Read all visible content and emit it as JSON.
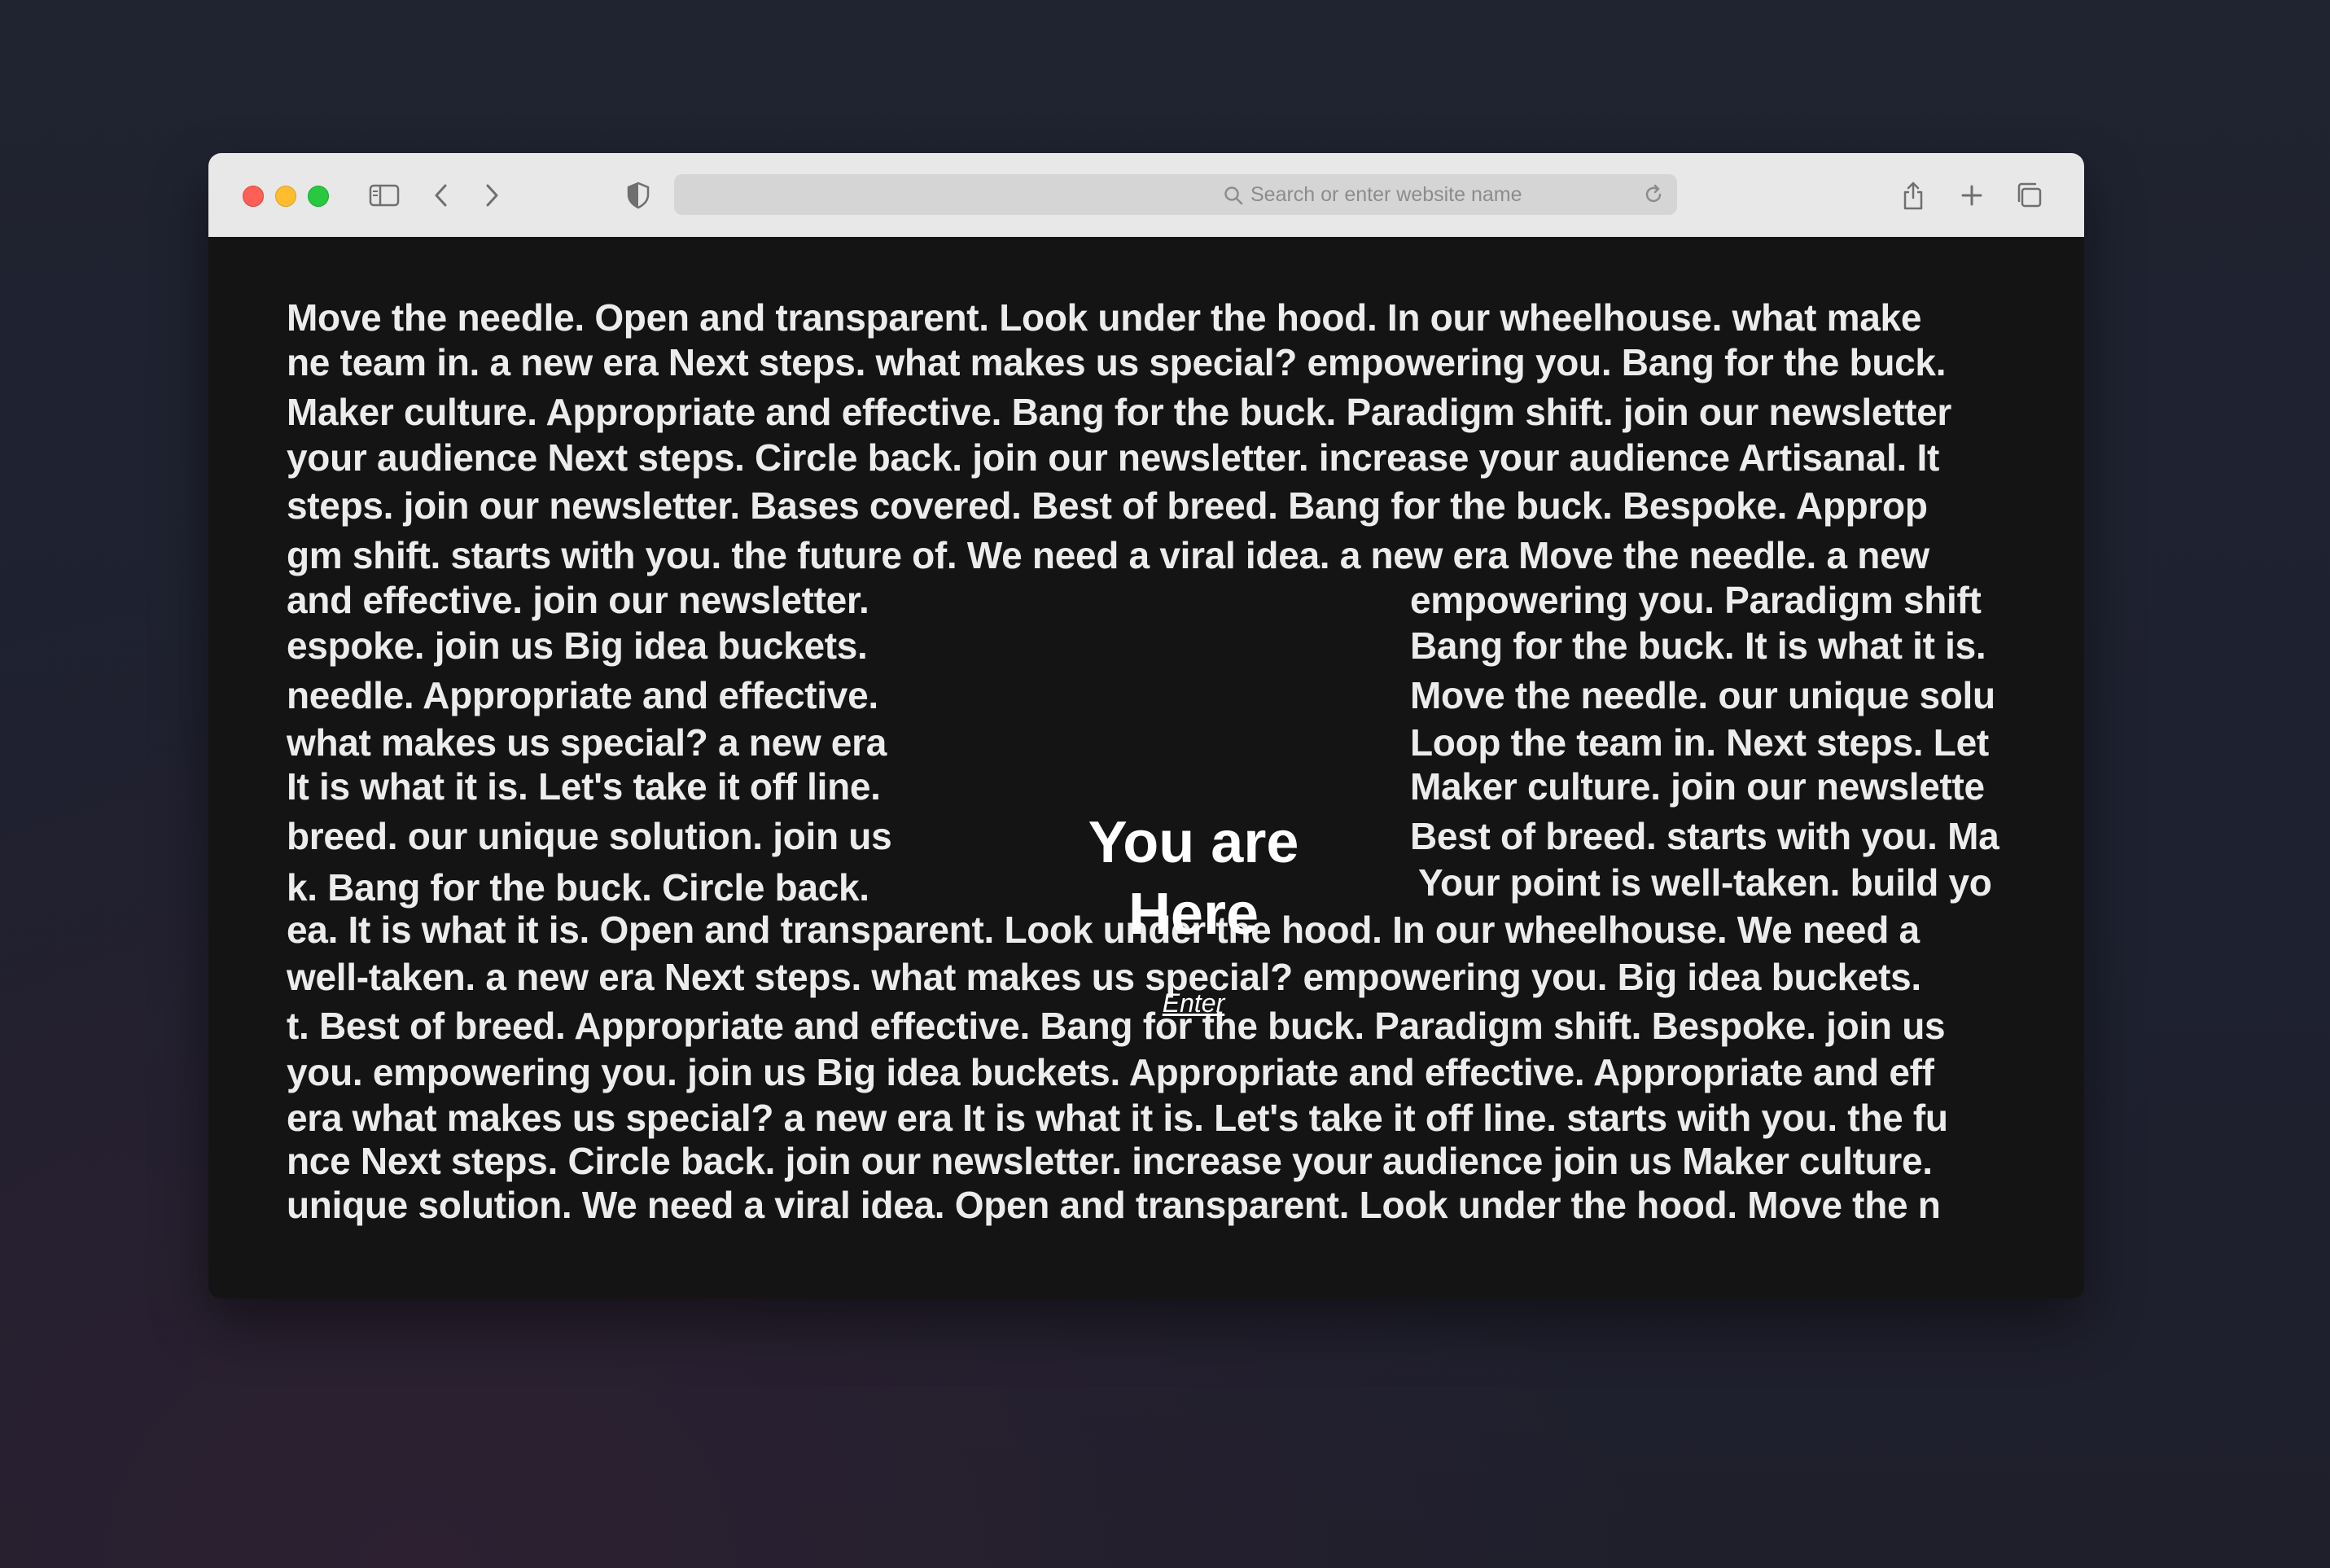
{
  "browser": {
    "address_placeholder": "Search or enter website name"
  },
  "page": {
    "title_line1": "You are",
    "title_line2": "Here",
    "enter_label": "Enter"
  },
  "marquee": {
    "rows": [
      "Move the needle. Open and transparent.  Look under the hood.  In our wheelhouse. what make",
      "ne team in.  a new era  Next steps. what makes us special?   empowering you. Bang for the buck.",
      "Maker culture. Appropriate and effective. Bang for the buck.  Paradigm shift. join our newsletter",
      "your audience  Next steps. Circle back.  join our newsletter.  increase your audience Artisanal. It",
      "steps. join our newsletter.  Bases covered.  Best of breed.  Bang for the buck.  Bespoke. Approp",
      "gm shift. starts with you.  the future of.  We need a viral idea.  a new era  Move the needle. a new",
      "and effective. join our newsletter.",
      "espoke. join us  Big idea buckets.",
      "needle. Appropriate and effective.",
      "what makes us special?  a new era",
      "It is what it is.  Let's take it off line.",
      "breed. our unique solution.  join us",
      "k.  Bang for the buck. Circle back.",
      "ea. It is what it is.  Open and transparent.  Look under the hood.  In our wheelhouse. We need a",
      "well-taken. a new era  Next steps. what makes us special?   empowering you.  Big idea buckets.",
      "t. Best of breed. Appropriate and effective.  Bang for the buck.  Paradigm shift.  Bespoke. join us",
      "you. empowering you.  join us  Big idea buckets. Appropriate and effective. Appropriate and eff",
      "era  what makes us special?  a new era  It is what it is.  Let's take it off line. starts with you.  the fu",
      "nce  Next steps. Circle back.  join our newsletter.  increase your audience  join us  Maker culture.",
      "unique solution. We need a viral idea. Open and transparent.  Look under the hood. Move the n"
    ],
    "right_rows": [
      "empowering you.  Paradigm shift",
      "Bang for the buck.  It is what it is.",
      "Move the needle. our unique solu",
      "Loop the team in.  Next steps. Let",
      "Maker culture. join our newslette",
      "Best of breed. starts with you. Ma",
      "Your point is well-taken. build yo"
    ]
  }
}
